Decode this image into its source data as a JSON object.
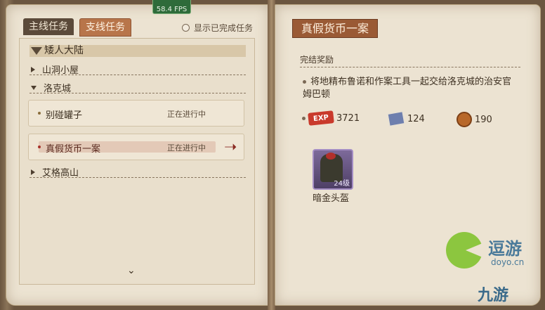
{
  "fps": "58.4 FPS",
  "left": {
    "tabs": {
      "main": "主线任务",
      "side": "支线任务"
    },
    "show_completed": "显示已完成任务",
    "regions": [
      {
        "label": "矮人大陆"
      },
      {
        "label": "山洞小屋"
      },
      {
        "label": "洛克城"
      },
      {
        "label": "艾格高山"
      }
    ],
    "quests": [
      {
        "name": "别碰罐子",
        "status": "正在进行中"
      },
      {
        "name": "真假货币一案",
        "status": "正在进行中"
      }
    ]
  },
  "right": {
    "title": "真假货币一案",
    "section": "完结奖励",
    "description": "将地精布鲁诺和作案工具一起交给洛克城的治安官姆巴顿",
    "rewards": {
      "exp_label": "EXP",
      "exp": "3721",
      "book": "124",
      "coin": "190"
    },
    "item": {
      "level": "24级",
      "name": "暗金头盔"
    }
  },
  "watermark": {
    "brand": "逗游",
    "domain": "doyo.cn",
    "brand2": "九游"
  }
}
